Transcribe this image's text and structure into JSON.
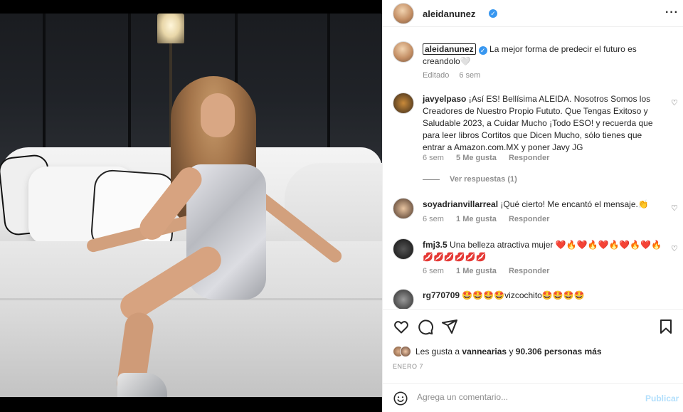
{
  "header": {
    "username": "aleidanunez",
    "verified_mark": "✓",
    "more_icon": "more-icon"
  },
  "caption": {
    "username": "aleidanunez",
    "text": "La mejor forma de predecir el futuro es creandolo🤍",
    "edited": "Editado",
    "time": "6 sem"
  },
  "comments": [
    {
      "username": "javyelpaso",
      "text": "¡Así ES! Bellísima ALEIDA. Nosotros Somos los Creadores de Nuestro Propio Fututo. Que Tengas Exitoso y Saludable 2023, a Cuidar Mucho ¡Todo ESO! y recuerda que para leer libros Cortitos que Dicen Mucho, sólo tienes que entrar a Amazon.com.MX y poner Javy JG",
      "time": "6 sem",
      "likes": "5 Me gusta",
      "reply": "Responder",
      "view_replies": "Ver respuestas (1)"
    },
    {
      "username": "soyadrianvillarreal",
      "text": "¡Qué cierto! Me encantó el mensaje.👏",
      "time": "6 sem",
      "likes": "1 Me gusta",
      "reply": "Responder"
    },
    {
      "username": "fmj3.5",
      "text": "Una belleza atractiva mujer ❤️🔥❤️🔥❤️🔥❤️🔥❤️🔥 💋💋💋💋💋💋",
      "time": "6 sem",
      "likes": "1 Me gusta",
      "reply": "Responder"
    },
    {
      "username": "rg770709",
      "text": "🤩🤩🤩🤩vizcochito🤩🤩🤩🤩"
    }
  ],
  "likes": {
    "prefix": "Les gusta a",
    "user": "vannearias",
    "connector": "y",
    "count": "90.306 personas más"
  },
  "date": "ENERO 7",
  "add_comment": {
    "placeholder": "Agrega un comentario...",
    "publish": "Publicar"
  },
  "colors": {
    "verified": "#3897f0",
    "publish_disabled": "#b2dffc",
    "meta_gray": "#8e8e8e"
  }
}
